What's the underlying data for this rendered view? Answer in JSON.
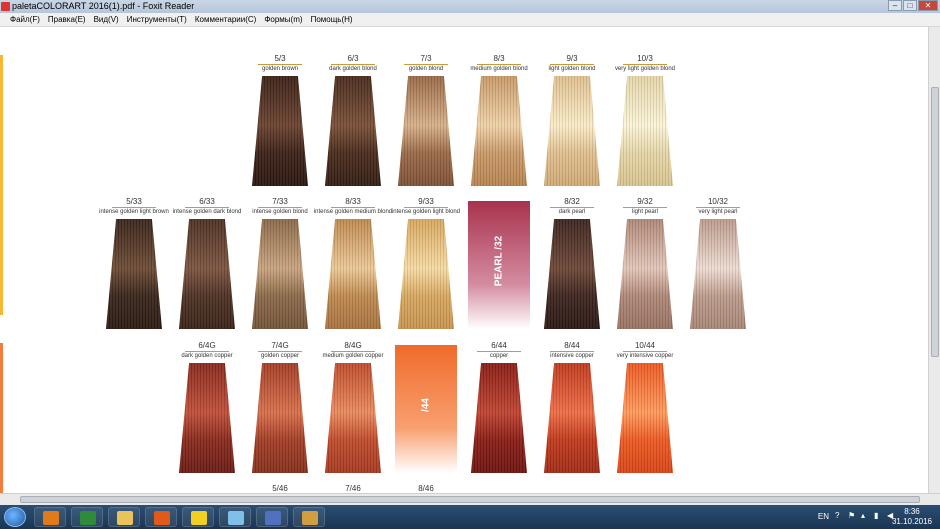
{
  "window": {
    "title": "paletaCOLORART 2016(1).pdf - Foxit Reader",
    "buttons": [
      "–",
      "□",
      "✕"
    ]
  },
  "menu": [
    "Файл(F)",
    "Правка(E)",
    "Вид(V)",
    "Инструменты(T)",
    "Комментарии(C)",
    "Формы(m)",
    "Помощь(H)"
  ],
  "colors": {
    "left_strip_top": "#f7b733",
    "left_strip_bottom": "#f47c3c",
    "accent_rule": "#c99a3a"
  },
  "palette_rows": [
    [
      {
        "code": "5/3",
        "desc": "golden brown",
        "colors": [
          "#3d2218",
          "#6b4330",
          "#2a1610"
        ]
      },
      {
        "code": "6/3",
        "desc": "dark golden blond",
        "colors": [
          "#4a2c1e",
          "#7a5038",
          "#331d13"
        ]
      },
      {
        "code": "7/3",
        "desc": "golden blond",
        "colors": [
          "#9a6a48",
          "#d6b08a",
          "#7e5236"
        ]
      },
      {
        "code": "8/3",
        "desc": "medium golden blond",
        "colors": [
          "#c99a6a",
          "#f0d2a8",
          "#b88450"
        ]
      },
      {
        "code": "9/3",
        "desc": "light golden blond",
        "colors": [
          "#e0c090",
          "#fbecc8",
          "#d2aa74"
        ]
      },
      {
        "code": "10/3",
        "desc": "very light golden blond",
        "colors": [
          "#e6d6a8",
          "#fbf4d8",
          "#d8c48e"
        ]
      }
    ],
    [
      {
        "code": "5/33",
        "desc": "intense golden light brown",
        "colors": [
          "#3a261c",
          "#6e4c36",
          "#2a1a12"
        ]
      },
      {
        "code": "6/33",
        "desc": "intense golden dark blond",
        "colors": [
          "#4e3224",
          "#7c5440",
          "#3a2218"
        ]
      },
      {
        "code": "7/33",
        "desc": "intense golden blond",
        "colors": [
          "#8c6a4a",
          "#c8a47e",
          "#74543a"
        ]
      },
      {
        "code": "8/33",
        "desc": "intense golden medium blond",
        "colors": [
          "#c08a50",
          "#ecc896",
          "#a87240"
        ]
      },
      {
        "code": "9/33",
        "desc": "intense golden light blond",
        "colors": [
          "#d8a860",
          "#f6dba4",
          "#c89450"
        ]
      },
      {
        "type": "banner",
        "label": "PEARL",
        "sub": "/32",
        "colors": [
          "#a8324e",
          "#d48ca0",
          "#ffffff"
        ]
      },
      {
        "code": "8/32",
        "desc": "dark pearl",
        "colors": [
          "#3e2620",
          "#6e4838",
          "#2a1814"
        ]
      },
      {
        "code": "9/32",
        "desc": "light pearl",
        "colors": [
          "#b08878",
          "#e2c6b8",
          "#9a7262"
        ]
      },
      {
        "code": "10/32",
        "desc": "very light pearl",
        "colors": [
          "#bc9c8c",
          "#eedcd2",
          "#a88676"
        ]
      }
    ],
    [
      {
        "code": "6/4G",
        "desc": "dark golden copper",
        "colors": [
          "#8a2a1e",
          "#c0503a",
          "#6a1c14"
        ]
      },
      {
        "code": "7/4G",
        "desc": "golden copper",
        "colors": [
          "#a43e26",
          "#d8704c",
          "#84301c"
        ]
      },
      {
        "code": "8/4G",
        "desc": "medium golden copper",
        "colors": [
          "#c04c2c",
          "#ea8a5e",
          "#a63a22"
        ]
      },
      {
        "type": "banner",
        "label": "",
        "sub": "/44",
        "colors": [
          "#f06a2a",
          "#f8a070",
          "#ffffff"
        ]
      },
      {
        "code": "6/44",
        "desc": "copper",
        "colors": [
          "#8a1e16",
          "#c04432",
          "#6e1410"
        ]
      },
      {
        "code": "8/44",
        "desc": "intensive copper",
        "colors": [
          "#c23a1e",
          "#ee6e46",
          "#a22c16"
        ]
      },
      {
        "code": "10/44",
        "desc": "very intensive copper",
        "colors": [
          "#ee5a22",
          "#ff9a5c",
          "#d84618"
        ]
      }
    ],
    [
      {
        "code": "5/46"
      },
      {
        "code": "7/46"
      },
      {
        "code": "8/46"
      }
    ]
  ],
  "taskbar": {
    "apps": [
      "media-player-icon",
      "excel-icon",
      "file-manager-icon",
      "firefox-icon",
      "batman-icon",
      "folder-icon",
      "control-panel-icon",
      "foxit-reader-icon"
    ],
    "lang": "EN",
    "time": "8:36",
    "date": "31.10.2016"
  }
}
